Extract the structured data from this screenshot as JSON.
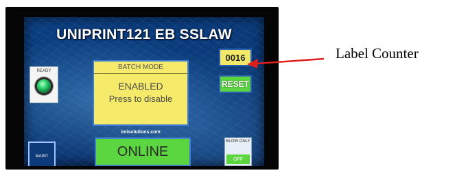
{
  "hmi": {
    "title": "UNIPRINT121 EB SSLAW",
    "label_counter": "0016",
    "reset_label": "RESET",
    "ready_label": "READY",
    "batch": {
      "header": "BATCH MODE",
      "status": "ENABLED",
      "action": "Press to disable"
    },
    "website": "imisolutions.com",
    "maint_label": "MAINT",
    "online_label": "ONLINE",
    "blow_only": {
      "label": "BLOW ONLY",
      "state": "OFF"
    }
  },
  "annotation": {
    "callout_text": "Label Counter",
    "arrow_color": "#e0201b"
  },
  "colors": {
    "screen_blue": "#0b3f82",
    "button_yellow": "#f5ea6a",
    "button_green": "#5cd640",
    "led_green": "#2bd36c"
  },
  "icons": {
    "ready_indicator": "green-led-icon",
    "callout_arrow": "red-arrow-icon"
  }
}
